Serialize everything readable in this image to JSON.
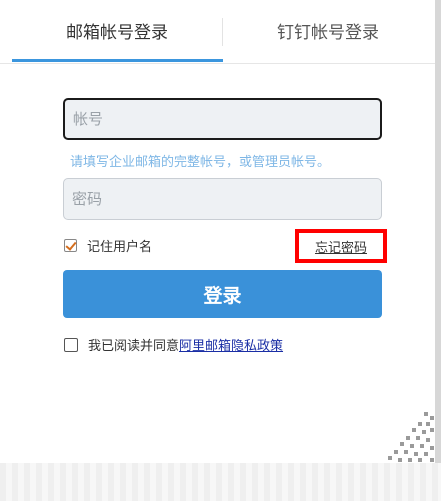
{
  "tabs": [
    {
      "label": "邮箱帐号登录",
      "active": true
    },
    {
      "label": "钉钉帐号登录",
      "active": false
    }
  ],
  "account": {
    "value": "",
    "placeholder": "帐号"
  },
  "hint": "请填写企业邮箱的完整帐号，或管理员帐号。",
  "password": {
    "value": "",
    "placeholder": "密码"
  },
  "remember": {
    "label": "记住用户名",
    "checked": true
  },
  "forgot_label": "忘记密码",
  "login_label": "登录",
  "agree": {
    "prefix": "我已阅读并同意",
    "link": "阿里邮箱隐私政策",
    "checked": false
  },
  "colors": {
    "accent": "#3a91d9",
    "highlight": "#ff0000",
    "link": "#1a2ea5"
  }
}
